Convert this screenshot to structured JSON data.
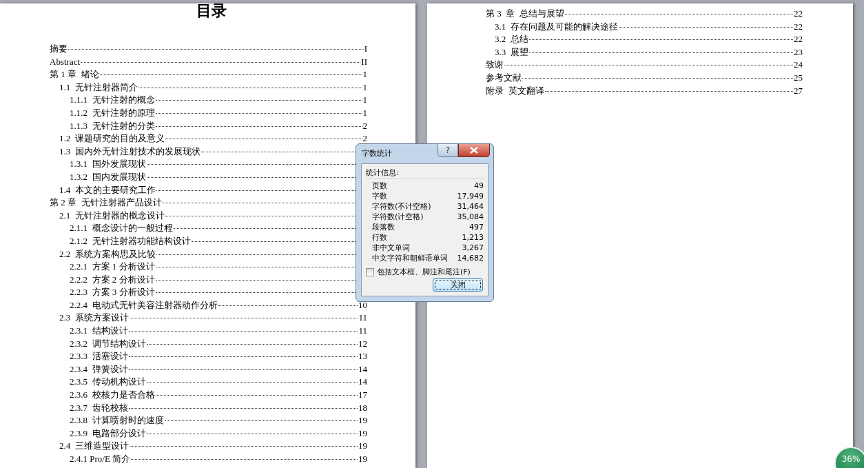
{
  "pages": [
    {
      "title": "目录",
      "entries": [
        {
          "text": "摘要",
          "page": "I"
        },
        {
          "text": "Abstract",
          "page": "II"
        },
        {
          "text": "第 1 章  绪论",
          "page": "1",
          "children": [
            {
              "text": "1.1  无针注射器简介",
              "page": "1",
              "children": [
                {
                  "text": "1.1.1  无针注射的概念",
                  "page": "1"
                },
                {
                  "text": "1.1.2  无针注射的原理",
                  "page": "1"
                },
                {
                  "text": "1.1.3  无针注射的分类",
                  "page": "2"
                }
              ]
            },
            {
              "text": "1.2  课题研究的目的及意义",
              "page": "2"
            },
            {
              "text": "1.3  国内外无针注射技术的发展现状",
              "children": [
                {
                  "text": "1.3.1  国外发展现状"
                },
                {
                  "text": "1.3.2  国内发展现状"
                }
              ]
            },
            {
              "text": "1.4  本文的主要研究工作"
            }
          ]
        },
        {
          "text": "第 2 章  无针注射器产品设计",
          "children": [
            {
              "text": "2.1  无针注射器的概念设计",
              "children": [
                {
                  "text": "2.1.1  概念设计的一般过程"
                },
                {
                  "text": "2.1.2  无针注射器功能结构设计"
                }
              ]
            },
            {
              "text": "2.2  系统方案构思及比较",
              "children": [
                {
                  "text": "2.2.1  方案 1 分析设计"
                },
                {
                  "text": "2.2.2  方案 2 分析设计"
                },
                {
                  "text": "2.2.3  方案 3 分析设计"
                },
                {
                  "text": "2.2.4  电动式无针美容注射器动作分析",
                  "page": "10"
                }
              ]
            },
            {
              "text": "2.3  系统方案设计",
              "page": "11",
              "children": [
                {
                  "text": "2.3.1  结构设计",
                  "page": "11"
                },
                {
                  "text": "2.3.2  调节结构设计",
                  "page": "12"
                },
                {
                  "text": "2.3.3  活塞设计",
                  "page": "13"
                },
                {
                  "text": "2.3.4  弹簧设计",
                  "page": "14"
                },
                {
                  "text": "2.3.5  传动机构设计",
                  "page": "14"
                },
                {
                  "text": "2.3.6  校核力是否合格",
                  "page": "17"
                },
                {
                  "text": "2.3.7  齿轮校核",
                  "page": "18"
                },
                {
                  "text": "2.3.8  计算喷射时的速度",
                  "page": "19"
                },
                {
                  "text": "2.3.9  电路部分设计",
                  "page": "19"
                }
              ]
            },
            {
              "text": "2.4  三维造型设计",
              "page": "19",
              "children": [
                {
                  "text": "2.4.1 Pro/E 简介",
                  "page": "19"
                }
              ]
            }
          ]
        }
      ]
    },
    {
      "entries": [
        {
          "text": "第 3  章  总结与展望",
          "page": "22",
          "children": [
            {
              "text": "3.1  存在问题及可能的解决途径",
              "page": "22"
            },
            {
              "text": "3.2  总结",
              "page": "22"
            },
            {
              "text": "3.3  展望",
              "page": "23"
            }
          ]
        },
        {
          "text": "致谢",
          "page": "24"
        },
        {
          "text": "参考文献",
          "page": "25"
        },
        {
          "text": "附录  英文翻译",
          "page": "27"
        }
      ]
    }
  ],
  "dialog": {
    "title": "字数统计",
    "help_button": "?",
    "group_label": "统计信息:",
    "stats": [
      {
        "label": "页数",
        "value": "49"
      },
      {
        "label": "字数",
        "value": "17,949"
      },
      {
        "label": "字符数(不计空格)",
        "value": "31,464"
      },
      {
        "label": "字符数(计空格)",
        "value": "35,084"
      },
      {
        "label": "段落数",
        "value": "497"
      },
      {
        "label": "行数",
        "value": "1,213"
      },
      {
        "label": "非中文单词",
        "value": "3,267"
      },
      {
        "label": "中文字符和朝鲜语单词",
        "value": "14,682"
      }
    ],
    "checkbox": {
      "label": "包括文本框、脚注和尾注(F)",
      "checked": false
    },
    "close_button": "关闭"
  },
  "zoom_badge": "36%"
}
